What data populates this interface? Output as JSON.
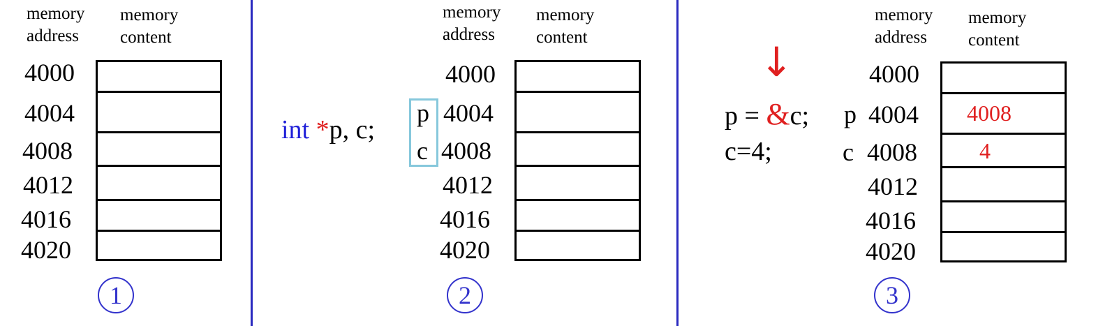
{
  "headers": {
    "address": [
      "memory",
      "address"
    ],
    "content": [
      "memory",
      "content"
    ]
  },
  "addresses": [
    "4000",
    "4004",
    "4008",
    "4012",
    "4016",
    "4020"
  ],
  "panel2": {
    "declaration": {
      "keyword": "int",
      "star": "*",
      "rest": "p, c;"
    },
    "labels": {
      "p": "p",
      "c": "c"
    }
  },
  "panel3": {
    "arrow": "↓",
    "statement1": {
      "prefix": "p = ",
      "amp": "&",
      "suffix": "c;"
    },
    "statement2": "c=4;",
    "labels": {
      "p": "p",
      "c": "c"
    },
    "values": {
      "cell4004": "4008",
      "cell4008": "4"
    }
  },
  "steps": [
    "1",
    "2",
    "3"
  ],
  "colors": {
    "keyword": "#1f1fd8",
    "accent": "#e02020",
    "divider": "#2a2ac0",
    "highlight": "#86c8dc"
  }
}
